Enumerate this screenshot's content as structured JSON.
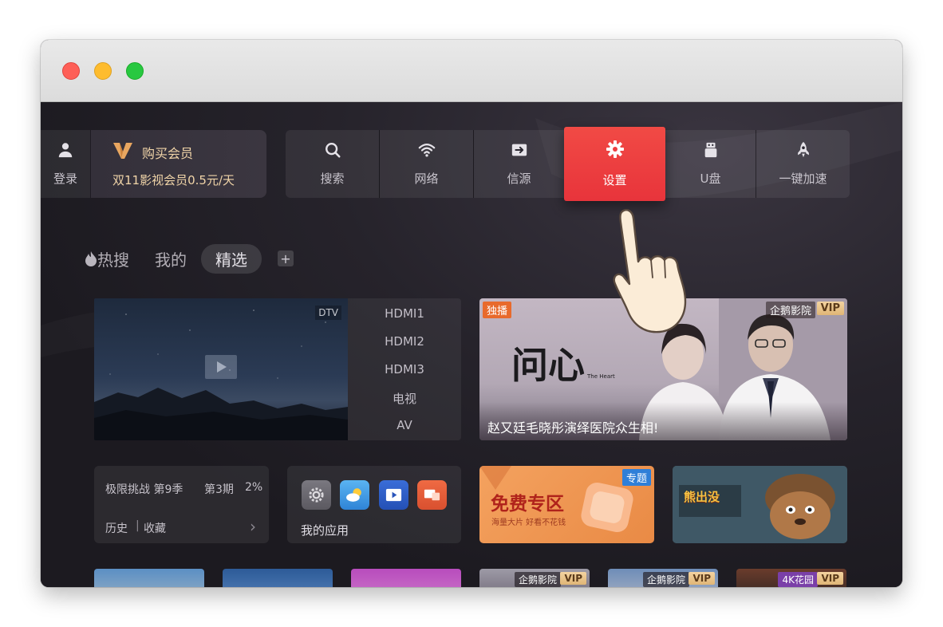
{
  "window": {
    "title": ""
  },
  "top_nav": {
    "login_label": "登录",
    "vip_title": "购买会员",
    "vip_subtitle": "双11影视会员0.5元/天",
    "buttons": [
      {
        "label": "搜索",
        "icon": "search-icon"
      },
      {
        "label": "网络",
        "icon": "wifi-icon"
      },
      {
        "label": "信源",
        "icon": "input-source-icon"
      },
      {
        "label": "设置",
        "icon": "gear-icon",
        "focused": true
      },
      {
        "label": "U盘",
        "icon": "usb-drive-icon"
      },
      {
        "label": "一键加速",
        "icon": "rocket-icon"
      }
    ]
  },
  "tabs": {
    "hot": "热搜",
    "mine": "我的",
    "selected": "精选",
    "add": "+"
  },
  "live_tv": {
    "tag": "DTV",
    "sources": [
      "HDMI1",
      "HDMI2",
      "HDMI3",
      "电视",
      "AV"
    ]
  },
  "banner": {
    "badge_left": "独播",
    "badge_brand": "企鹅影院",
    "badge_vip": "VIP",
    "logo_text": "问心",
    "logo_sub": "The Heart",
    "caption": "赵又廷毛晓彤演绎医院众生相!"
  },
  "history_card": {
    "show": "极限挑战 第9季",
    "episode": "第3期",
    "progress": "2%",
    "history_label": "历史",
    "separator": "|",
    "favorites_label": "收藏",
    "arrow": "›"
  },
  "apps_card": {
    "label": "我的应用"
  },
  "free_card": {
    "badge": "专题",
    "title": "免费专区",
    "subtitle": "海量大片 好看不花钱"
  },
  "bear_card": {
    "title": "熊出没"
  },
  "bottom_row": {
    "badges": [
      {
        "brand": "企鹅影院",
        "vip": "VIP"
      },
      {
        "brand": "企鹅影院",
        "vip": "VIP"
      },
      {
        "brand": "4K花园",
        "vip": "VIP"
      }
    ]
  },
  "colors": {
    "accent": "#ee3f42",
    "vip_gold": "#f0d4a8",
    "background": "#1c1a20"
  }
}
